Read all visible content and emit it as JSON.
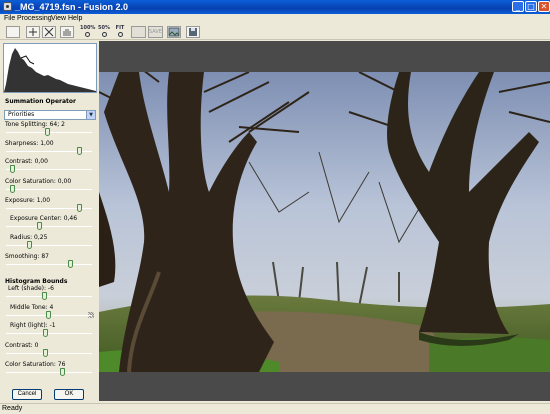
{
  "window": {
    "title": "_MG_4719.fsn - Fusion 2.0",
    "min_glyph": "_",
    "max_glyph": "□",
    "close_glyph": "✕",
    "app_icon": "fusion-app-icon"
  },
  "menu": [
    "File",
    "Processing",
    "View",
    "Help"
  ],
  "toolbar": {
    "zoom_100": "100%",
    "zoom_50": "50%",
    "zoom_fit": "FIT",
    "save_label": "SAVE"
  },
  "panel": {
    "title": "Summation Operator",
    "operator_value": "Priorities",
    "sliders": [
      {
        "label": "Tone Splitting: 64; 2",
        "level": 0.48
      },
      {
        "label": "Sharpness: 1,00",
        "level": 0.88
      },
      {
        "label": "Contrast: 0,00",
        "level": 0.05
      },
      {
        "label": "Color Saturation: 0,00",
        "level": 0.05
      },
      {
        "label": "Exposure: 1,00",
        "level": 0.88
      },
      {
        "label": "Exposure Center: 0,46",
        "level": 0.38
      },
      {
        "label": "Radius: 0,25",
        "level": 0.26
      },
      {
        "label": "Smoothing: 87",
        "level": 0.77
      }
    ],
    "histogram_title": "Histogram Bounds",
    "bounds": [
      {
        "label": "Left (shade): -6",
        "level": 0.44
      },
      {
        "label": "Middle Tone: 4",
        "level": 0.49
      },
      {
        "label": "Right (light): -1",
        "level": 0.46
      },
      {
        "label": "Contrast: 0",
        "level": 0.46
      },
      {
        "label": "Color Saturation: 76",
        "level": 0.67
      }
    ],
    "cancel_label": "Cancel",
    "ok_label": "OK"
  },
  "status": "Ready",
  "colors": {
    "titlebar": "#0A5FD8",
    "panel_bg": "#ECE9D8",
    "canvas_bg": "#4A4A4A",
    "close_button": "#D9532C"
  }
}
